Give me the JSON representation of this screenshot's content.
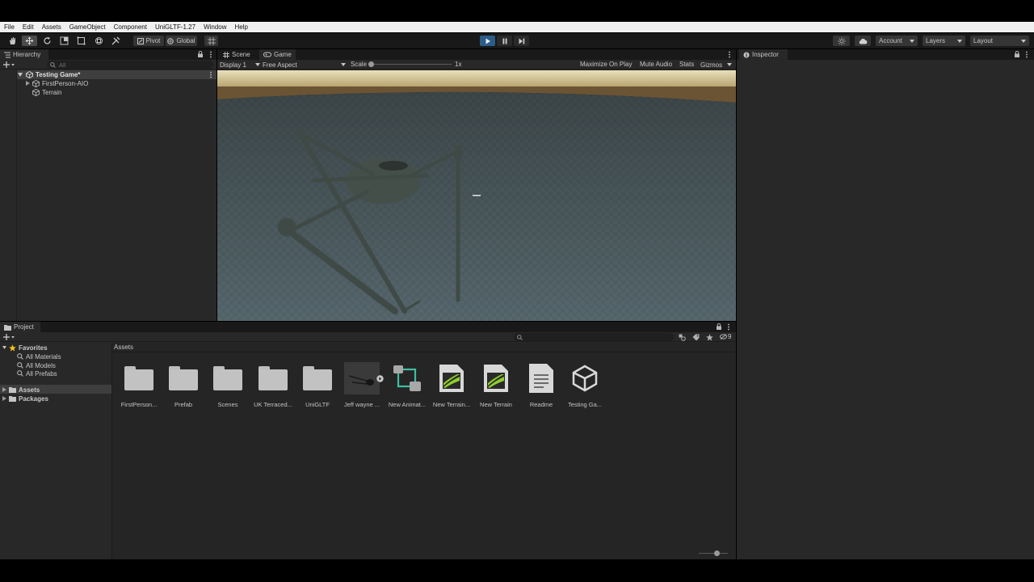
{
  "menu": [
    "File",
    "Edit",
    "Assets",
    "GameObject",
    "Component",
    "UniGLTF-1.27",
    "Window",
    "Help"
  ],
  "toolbar": {
    "pivot_label": "Pivot",
    "global_label": "Global",
    "account_label": "Account",
    "layers_label": "Layers",
    "layout_label": "Layout"
  },
  "hierarchy": {
    "tab_label": "Hierarchy",
    "search_placeholder": "All",
    "scene_name": "Testing Game*",
    "items": [
      "FirstPerson-AIO",
      "Terrain"
    ]
  },
  "game_view": {
    "tabs": [
      "Scene",
      "Game"
    ],
    "display": "Display 1",
    "aspect": "Free Aspect",
    "scale_label": "Scale",
    "scale_value": "1x",
    "scale_position": 0,
    "right_options": [
      "Maximize On Play",
      "Mute Audio",
      "Stats",
      "Gizmos"
    ]
  },
  "inspector": {
    "tab_label": "Inspector"
  },
  "project": {
    "tab_label": "Project",
    "breadcrumb": "Assets",
    "hidden_count": "9",
    "favorites": {
      "label": "Favorites",
      "items": [
        "All Materials",
        "All Models",
        "All Prefabs"
      ]
    },
    "roots": [
      "Assets",
      "Packages"
    ],
    "assets": [
      {
        "label": "FirstPerson...",
        "icon": "folder-icon"
      },
      {
        "label": "Prefab",
        "icon": "folder-icon"
      },
      {
        "label": "Scenes",
        "icon": "folder-icon"
      },
      {
        "label": "UK Terraced...",
        "icon": "folder-icon"
      },
      {
        "label": "UniGLTF",
        "icon": "folder-icon"
      },
      {
        "label": "Jeff wayne ...",
        "icon": "model-thumbnail"
      },
      {
        "label": "New Animat...",
        "icon": "animator-controller-icon"
      },
      {
        "label": "New Terrain...",
        "icon": "terrain-layer-icon"
      },
      {
        "label": "New Terrain",
        "icon": "terrain-data-icon"
      },
      {
        "label": "Readme",
        "icon": "text-asset-icon"
      },
      {
        "label": "Testing Ga...",
        "icon": "unity-scene-icon"
      }
    ]
  },
  "colors": {
    "accent": "#2c5d87",
    "panel": "#282828",
    "tab_bar": "#191919",
    "terrain_icon": "#8fce2b"
  }
}
